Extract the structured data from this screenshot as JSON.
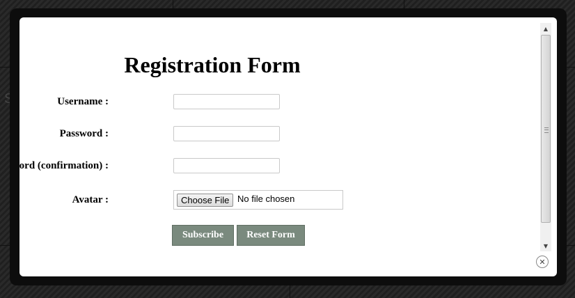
{
  "form": {
    "title": "Registration Form",
    "fields": [
      {
        "label": "Username :",
        "value": ""
      },
      {
        "label": "Password :",
        "value": ""
      },
      {
        "label": "Password (confirmation) :",
        "value": ""
      }
    ],
    "avatar": {
      "label": "Avatar :",
      "button_label": "Choose File",
      "status": "No file chosen"
    },
    "buttons": {
      "subscribe": "Subscribe",
      "reset": "Reset Form"
    }
  },
  "background": {
    "fragment": "Se"
  },
  "icons": {
    "close": "close-icon",
    "scroll_up": "chevron-up-icon",
    "scroll_down": "chevron-down-icon"
  },
  "colors": {
    "button_bg": "#7a8a7e",
    "overlay": "#1f1f1f"
  }
}
